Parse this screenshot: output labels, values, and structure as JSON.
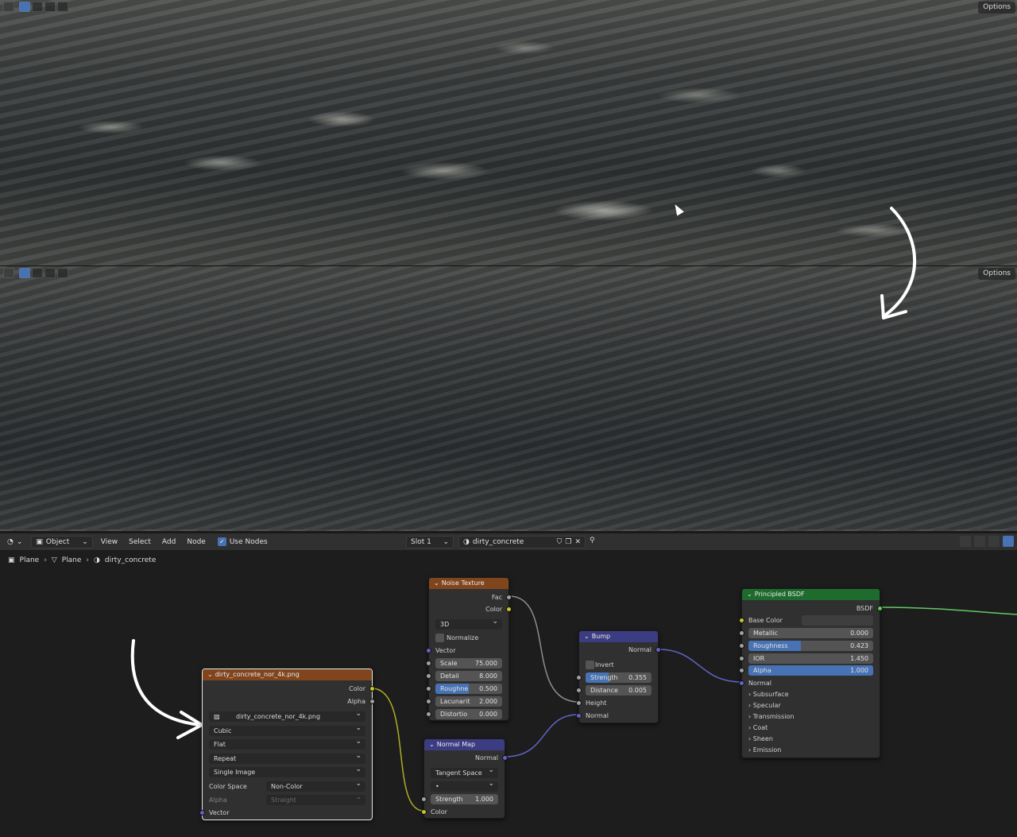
{
  "viewport_top": {
    "options_label": "Options"
  },
  "viewport_bottom": {
    "options_label": "Options"
  },
  "header": {
    "mode_label": "Object",
    "menus": [
      "View",
      "Select",
      "Add",
      "Node"
    ],
    "use_nodes_label": "Use Nodes",
    "use_nodes_checked": true,
    "slot_label": "Slot 1",
    "material_name": "dirty_concrete"
  },
  "breadcrumb": {
    "object": "Plane",
    "mesh": "Plane",
    "material": "dirty_concrete"
  },
  "image_node": {
    "title": "dirty_concrete_nor_4k.png",
    "out_color": "Color",
    "out_alpha": "Alpha",
    "image_name": "dirty_concrete_nor_4k.png",
    "interpolation": "Cubic",
    "projection": "Flat",
    "extension": "Repeat",
    "source": "Single Image",
    "color_space_label": "Color Space",
    "color_space_value": "Non-Color",
    "alpha_label": "Alpha",
    "alpha_value": "Straight",
    "in_vector": "Vector"
  },
  "noise_node": {
    "title": "Noise Texture",
    "out_fac": "Fac",
    "out_color": "Color",
    "dimensions": "3D",
    "normalize_label": "Normalize",
    "in_vector": "Vector",
    "scale_label": "Scale",
    "scale_value": "75.000",
    "detail_label": "Detail",
    "detail_value": "8.000",
    "roughness_label": "Roughne",
    "roughness_value": "0.500",
    "roughness_fraction": 0.5,
    "lacunarity_label": "Lacunarit",
    "lacunarity_value": "2.000",
    "distortion_label": "Distortio",
    "distortion_value": "0.000"
  },
  "bump_node": {
    "title": "Bump",
    "out_normal": "Normal",
    "invert_label": "Invert",
    "strength_label": "Strength",
    "strength_value": "0.355",
    "strength_fraction": 0.355,
    "distance_label": "Distance",
    "distance_value": "0.005",
    "in_height": "Height",
    "in_normal": "Normal"
  },
  "normal_map_node": {
    "title": "Normal Map",
    "out_normal": "Normal",
    "space": "Tangent Space",
    "uv_value": "•",
    "strength_label": "Strength",
    "strength_value": "1.000",
    "in_color": "Color"
  },
  "bsdf_node": {
    "title": "Principled BSDF",
    "out_bsdf": "BSDF",
    "base_color_label": "Base Color",
    "metallic_label": "Metallic",
    "metallic_value": "0.000",
    "roughness_label": "Roughness",
    "roughness_value": "0.423",
    "roughness_fraction": 0.423,
    "ior_label": "IOR",
    "ior_value": "1.450",
    "alpha_label": "Alpha",
    "alpha_value": "1.000",
    "alpha_fraction": 1.0,
    "normal_label": "Normal",
    "panels": [
      "Subsurface",
      "Specular",
      "Transmission",
      "Coat",
      "Sheen",
      "Emission"
    ]
  },
  "colors": {
    "image_header": "#81451e",
    "vector_header": "#3c3c83",
    "shader_header": "#1e6b2e",
    "socket_color": "#c7c729",
    "socket_float": "#a1a1a1",
    "socket_vector": "#6363c7",
    "socket_shader": "#63c763",
    "accent": "#4772b3"
  }
}
